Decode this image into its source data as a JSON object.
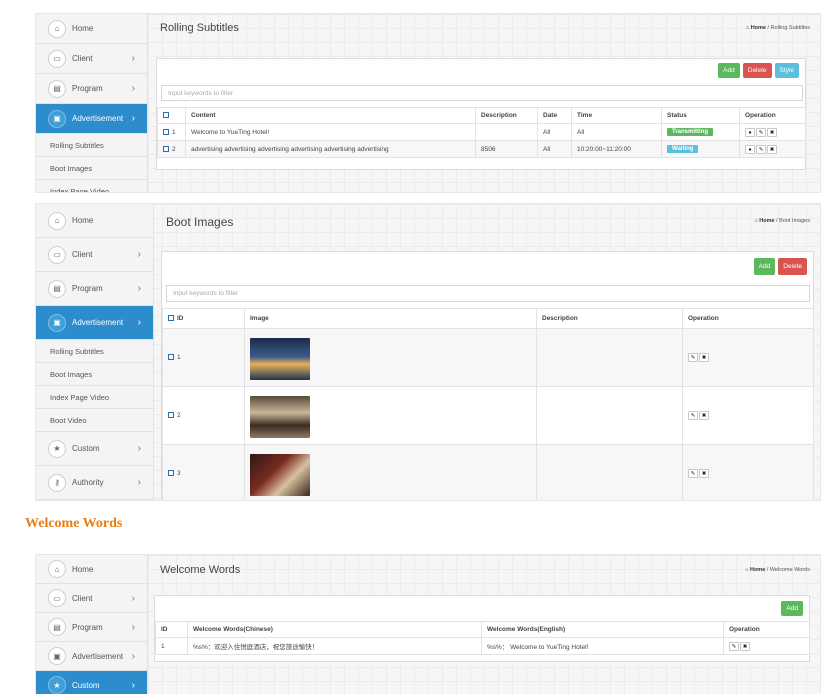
{
  "nav": {
    "home": "Home",
    "client": "Client",
    "program": "Program",
    "advertisement": "Advertisement",
    "custom": "Custom",
    "authority": "Authority",
    "chevron": "›",
    "sub_items": [
      "Rolling Subtitles",
      "Boot Images",
      "Index Page Video",
      "Boot Video"
    ]
  },
  "icons": {
    "home": "home-icon",
    "client": "monitor-icon",
    "program": "film-icon",
    "advertisement": "picture-icon",
    "custom": "star-icon",
    "authority": "key-icon",
    "breadcrumb": "home-icon",
    "user": "user-icon",
    "edit": "pencil-icon",
    "delete": "close-icon"
  },
  "colors": {
    "active": "#2c8ccc",
    "green": "#5cb85c",
    "red": "#d9534f",
    "blue": "#5bc0de",
    "heading": "#e87d17"
  },
  "panel1": {
    "title": "Rolling Subtitles",
    "crumb_home": "Home",
    "crumb_sep": "/",
    "crumb_current": "Rolling Subtitles",
    "buttons": {
      "add": "Add",
      "delete": "Delete",
      "style": "Style"
    },
    "filter_placeholder": "Input keywords to filter",
    "columns": [
      "Content",
      "Description",
      "Date",
      "Time",
      "Status",
      "Operation"
    ],
    "rows": [
      {
        "id": "1",
        "content": "Welcome to YueTing Hotel!",
        "description": "",
        "date": "All",
        "time": "All",
        "status": "Transmitting"
      },
      {
        "id": "2",
        "content": "advertising advertising advertising advertising advertising advertising",
        "description": "8506",
        "date": "All",
        "time": "10:20:00~11:20:00",
        "status": "Waiting"
      }
    ]
  },
  "panel2": {
    "title": "Boot Images",
    "crumb_home": "Home",
    "crumb_sep": "/",
    "crumb_current": "Boot Images",
    "buttons": {
      "add": "Add",
      "delete": "Delete"
    },
    "filter_placeholder": "Input keywords to filter",
    "columns": [
      "ID",
      "Image",
      "Description",
      "Operation"
    ],
    "rows": [
      {
        "id": "1"
      },
      {
        "id": "2"
      },
      {
        "id": "3"
      }
    ]
  },
  "section_heading": "Welcome Words",
  "panel3": {
    "title": "Welcome Words",
    "crumb_home": "Home",
    "crumb_sep": "/",
    "crumb_current": "Welcome Words",
    "buttons": {
      "add": "Add"
    },
    "columns": [
      "ID",
      "Welcome Words(Chinese)",
      "Welcome Words(English)",
      "Operation"
    ],
    "rows": [
      {
        "id": "1",
        "chinese": "%s%：欢迎入住悦庭酒店，祝您旅途愉快！",
        "english": "%s%： Welcome to YueTing Hotel!"
      }
    ]
  }
}
